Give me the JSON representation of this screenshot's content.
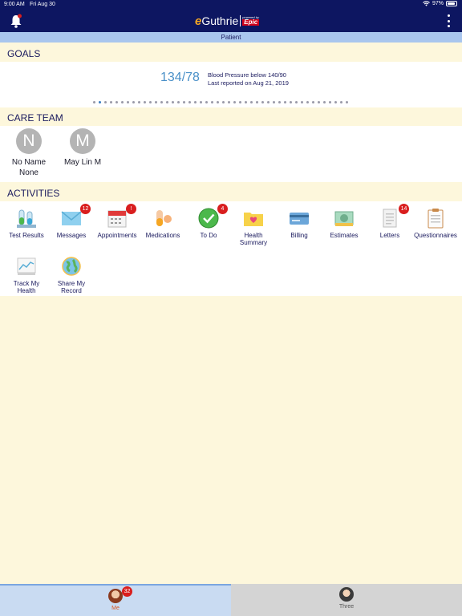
{
  "status_bar": {
    "time": "9:00 AM",
    "date": "Fri Aug 30",
    "battery": "97%"
  },
  "app": {
    "logo_e": "e",
    "logo_name": "Guthrie",
    "logo_powered": "powered by",
    "logo_epic": "Epic"
  },
  "patient_bar": "Patient",
  "goals": {
    "heading": "GOALS",
    "value": "134/78",
    "title": "Blood Pressure below 140/90",
    "subtitle": "Last reported on Aug 21, 2019"
  },
  "care_team": {
    "heading": "CARE TEAM",
    "members": [
      {
        "initial": "N",
        "line1": "No Name",
        "line2": "None"
      },
      {
        "initial": "M",
        "line1": "May Lin M",
        "line2": ""
      }
    ]
  },
  "activities": {
    "heading": "ACTIVITIES",
    "items": [
      {
        "label": "Test Results",
        "icon": "test-tubes-icon",
        "badge": ""
      },
      {
        "label": "Messages",
        "icon": "envelope-icon",
        "badge": "12"
      },
      {
        "label": "Appointments",
        "icon": "calendar-icon",
        "badge": "!"
      },
      {
        "label": "Medications",
        "icon": "pill-icon",
        "badge": ""
      },
      {
        "label": "To Do",
        "icon": "checkmark-icon",
        "badge": "4"
      },
      {
        "label": "Health Summary",
        "icon": "folder-heart-icon",
        "badge": ""
      },
      {
        "label": "Billing",
        "icon": "credit-card-icon",
        "badge": ""
      },
      {
        "label": "Estimates",
        "icon": "money-icon",
        "badge": ""
      },
      {
        "label": "Letters",
        "icon": "letter-icon",
        "badge": "14"
      },
      {
        "label": "Questionnaires",
        "icon": "clipboard-icon",
        "badge": ""
      },
      {
        "label": "Track My Health",
        "icon": "chart-icon",
        "badge": ""
      },
      {
        "label": "Share My Record",
        "icon": "globe-icon",
        "badge": ""
      }
    ]
  },
  "tabs": [
    {
      "label": "Me",
      "badge": "32"
    },
    {
      "label": "Three",
      "badge": ""
    }
  ],
  "colors": {
    "header": "#0d1661",
    "accent": "#4a90c8",
    "badge": "#d91e1e",
    "background": "#fdf7dc"
  }
}
